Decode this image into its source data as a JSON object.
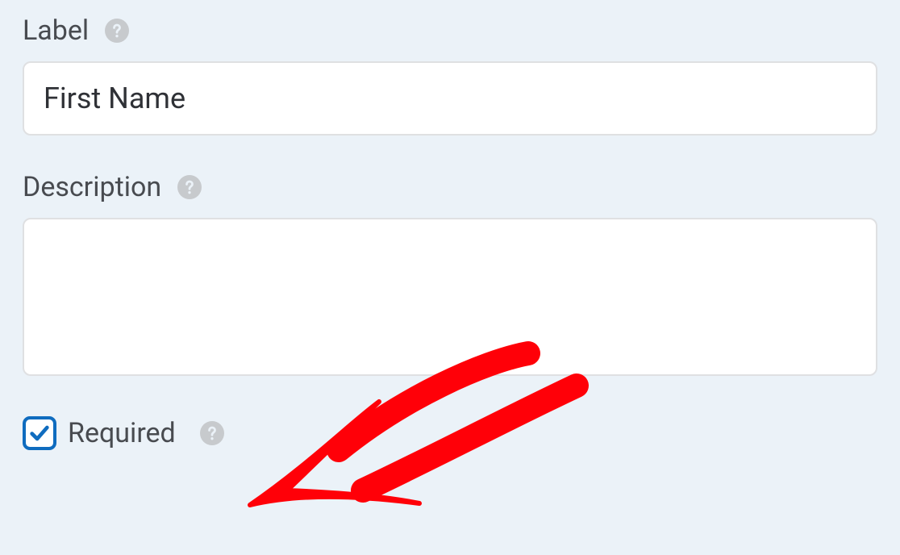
{
  "fields": {
    "label": {
      "title": "Label",
      "value": "First Name"
    },
    "description": {
      "title": "Description",
      "value": ""
    },
    "required": {
      "title": "Required",
      "checked": true
    }
  },
  "annotation": {
    "type": "hand-drawn-arrow",
    "color": "#ff0008"
  }
}
